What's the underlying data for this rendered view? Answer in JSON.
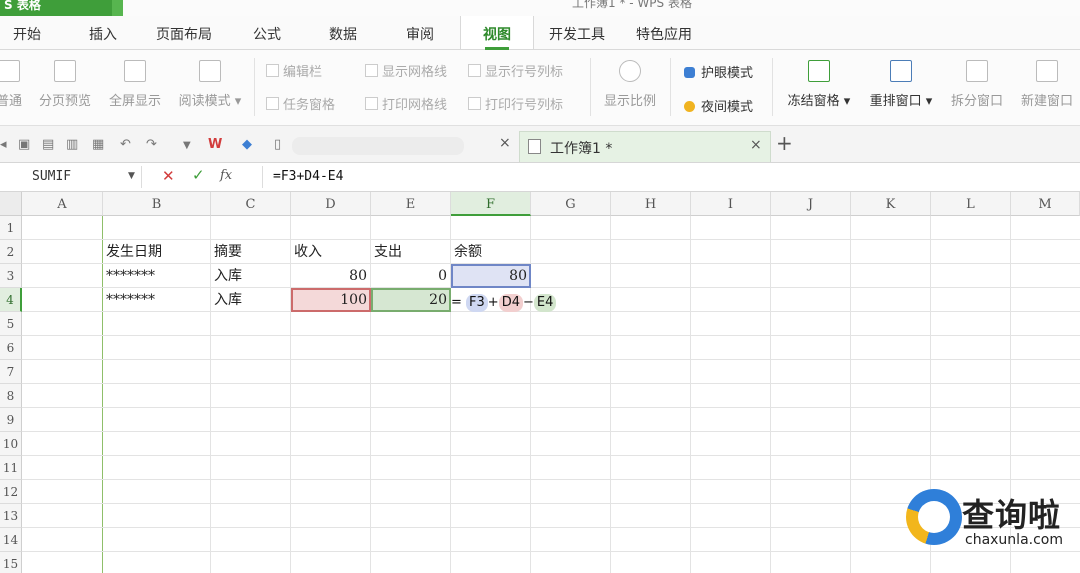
{
  "title_bar": {
    "app_badge": "S 表格",
    "doc_title": "工作簿1 * - WPS 表格"
  },
  "menu_tabs": [
    {
      "label": "开始"
    },
    {
      "label": "插入"
    },
    {
      "label": "页面布局"
    },
    {
      "label": "公式"
    },
    {
      "label": "数据"
    },
    {
      "label": "审阅"
    },
    {
      "label": "视图",
      "active": true
    },
    {
      "label": "开发工具"
    },
    {
      "label": "特色应用"
    }
  ],
  "ribbon": {
    "normal": "普通",
    "page_break_preview": "分页预览",
    "full_screen": "全屏显示",
    "reading_mode": "阅读模式",
    "formula_bar": "编辑栏",
    "task_pane": "任务窗格",
    "show_gridlines": "显示网格线",
    "print_gridlines": "打印网格线",
    "show_row_col_headers": "显示行号列标",
    "print_row_col_headers": "打印行号列标",
    "zoom": "显示比例",
    "eye_mode": "护眼模式",
    "night_mode": "夜间模式",
    "freeze_panes": "冻结窗格",
    "arrange_windows": "重排窗口",
    "split_window": "拆分窗口",
    "new_window": "新建窗口"
  },
  "doc_tabs": {
    "active_tab": "工作簿1 *",
    "close_glyph": "×",
    "new_tab_glyph": "+"
  },
  "formula_bar": {
    "name_box": "SUMIF",
    "cancel": "✕",
    "enter": "✓",
    "fx": "fx",
    "formula": "=F3+D4-E4"
  },
  "sheet": {
    "columns": [
      "A",
      "B",
      "C",
      "D",
      "E",
      "F",
      "G",
      "H",
      "I",
      "J",
      "K",
      "L",
      "M"
    ],
    "rows": [
      "1",
      "2",
      "3",
      "4",
      "5",
      "6",
      "7",
      "8",
      "9",
      "10",
      "11",
      "12",
      "13",
      "14",
      "15"
    ],
    "headers": {
      "date": "发生日期",
      "summary": "摘要",
      "income": "收入",
      "expense": "支出",
      "balance": "余额"
    },
    "row3": {
      "date": "*******",
      "summary": "入库",
      "income": "80",
      "expense": "0",
      "balance": "80"
    },
    "row4": {
      "date": "*******",
      "summary": "入库",
      "income": "100",
      "expense": "20"
    },
    "editing_formula": {
      "eq": "=",
      "t1": "F3",
      "op1": "+",
      "t2": "D4",
      "op2": "−",
      "t3": "E4"
    }
  },
  "watermark": {
    "name": "查询啦",
    "url": "chaxunla.com"
  },
  "colors": {
    "accent": "#3f9e3a",
    "ref_blue": "#6f86c6",
    "ref_red": "#cc6b6b",
    "ref_green": "#78ac6e"
  }
}
